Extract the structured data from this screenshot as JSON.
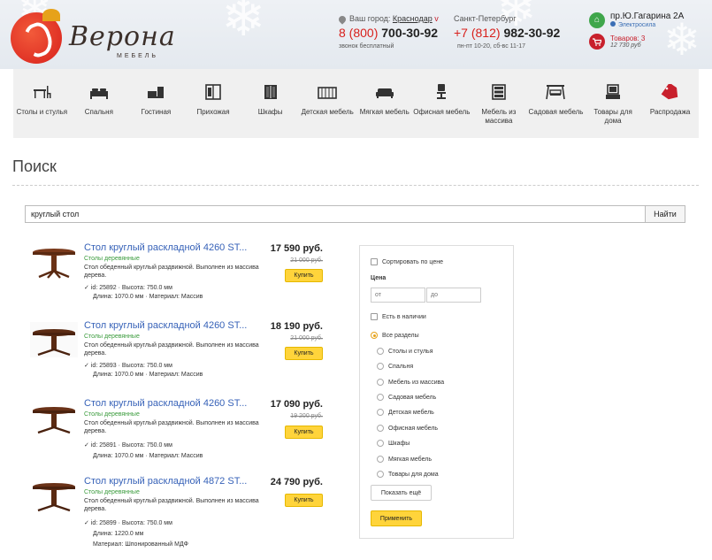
{
  "header": {
    "logo_text": "Верона",
    "logo_sub": "МЕБЕЛЬ",
    "city_label": "Ваш город:",
    "city_value": "Краснодар",
    "phone1_code": "8 (800)",
    "phone1_number": "700-30-92",
    "phone1_note": "звонок бесплатный",
    "city2": "Санкт-Петербург",
    "phone2_code": "+7 (812)",
    "phone2_number": "982-30-92",
    "phone2_note": "пн-пт 10-20, сб-вс 11-17",
    "address": "пр.Ю.Гагарина 2А",
    "metro": "Электросила",
    "cart_label": "Товаров: 3",
    "cart_sum": "12 730 руб"
  },
  "nav": [
    {
      "label": "Столы и стулья",
      "icon": "table-chair-icon"
    },
    {
      "label": "Спальня",
      "icon": "bed-icon"
    },
    {
      "label": "Гостиная",
      "icon": "sofa-icon"
    },
    {
      "label": "Прихожая",
      "icon": "wardrobe-icon"
    },
    {
      "label": "Шкафы",
      "icon": "cabinet-icon"
    },
    {
      "label": "Детская мебель",
      "icon": "kids-bed-icon"
    },
    {
      "label": "Мягкая мебель",
      "icon": "couch-icon"
    },
    {
      "label": "Офисная мебель",
      "icon": "office-chair-icon"
    },
    {
      "label": "Мебель из массива",
      "icon": "dresser-icon"
    },
    {
      "label": "Садовая мебель",
      "icon": "garden-swing-icon"
    },
    {
      "label": "Товары для дома",
      "icon": "home-goods-icon"
    },
    {
      "label": "Распродажа",
      "icon": "sale-tag-icon"
    }
  ],
  "page": {
    "title": "Поиск",
    "search_value": "круглый стол",
    "search_button": "Найти"
  },
  "results": [
    {
      "title": "Стол круглый раскладной 4260 ST...",
      "category": "Столы деревянные",
      "desc": "Стол обеденный круглый раздвижной. Выполнен из массива дерева.",
      "spec1": "id: 25892  ·  Высота: 750.0 мм",
      "spec2": "Длина: 1070.0 мм  ·  Материал: Массив",
      "spec3": "",
      "price": "17 590 руб.",
      "old_price": "21 000 руб.",
      "buy": "Купить"
    },
    {
      "title": "Стол круглый раскладной 4260 ST...",
      "category": "Столы деревянные",
      "desc": "Стол обеденный круглый раздвижной. Выполнен из массива дерева.",
      "spec1": "id: 25893  ·  Высота: 750.0 мм",
      "spec2": "Длина: 1070.0 мм  ·  Материал: Массив",
      "spec3": "",
      "price": "18 190 руб.",
      "old_price": "21 000 руб.",
      "buy": "Купить"
    },
    {
      "title": "Стол круглый раскладной 4260 ST...",
      "category": "Столы деревянные",
      "desc": "Стол обеденный круглый раздвижной. Выполнен из массива дерева.",
      "spec1": "id: 25891  ·  Высота: 750.0 мм",
      "spec2": "Длина: 1070.0 мм  ·  Материал: Массив",
      "spec3": "",
      "price": "17 090 руб.",
      "old_price": "19 200 руб.",
      "buy": "Купить"
    },
    {
      "title": "Стол круглый раскладной 4872 ST...",
      "category": "Столы деревянные",
      "desc": "Стол обеденный круглый раздвижной. Выполнен из массива дерева.",
      "spec1": "id: 25899  ·  Высота: 750.0 мм",
      "spec2": "Длина: 1220.0 мм",
      "spec3": "Материал: Шпонированный МДФ",
      "price": "24 790 руб.",
      "old_price": "",
      "buy": "Купить"
    }
  ],
  "filter": {
    "sort_by_price": "Сортировать по цене",
    "price_label": "Цена",
    "price_from": "от",
    "price_to": "до",
    "in_stock": "Есть в наличии",
    "sections": [
      "Все разделы",
      "Столы и стулья",
      "Спальня",
      "Мебель из массива",
      "Садовая мебель",
      "Детская мебель",
      "Офисная мебель",
      "Шкафы",
      "Мягкая мебель",
      "Товары для дома"
    ],
    "show_more": "Показать ещё",
    "apply": "Применить"
  },
  "colors": {
    "accent_red": "#d8201c",
    "link_blue": "#3762b8",
    "category_green": "#3a9b3c",
    "button_yellow": "#ffd43b"
  }
}
